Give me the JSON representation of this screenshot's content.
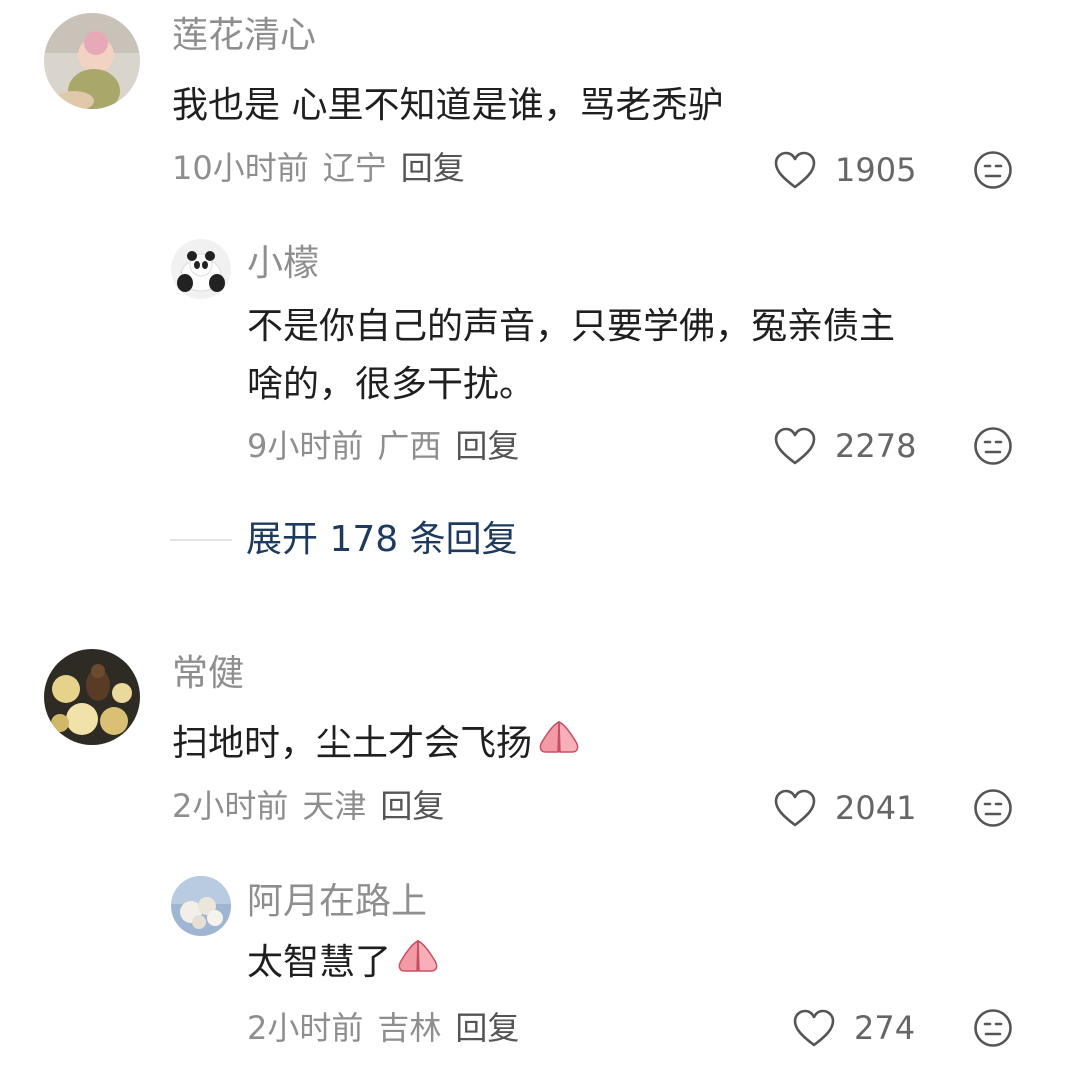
{
  "comments": [
    {
      "user": "莲花清心",
      "text": "我也是 心里不知道是谁，骂老秃驴",
      "time": "10小时前",
      "location": "辽宁",
      "reply_label": "回复",
      "likes": "1905",
      "replies": [
        {
          "user": "小檬",
          "text_line1": "不是你自己的声音，只要学佛，冤亲债主",
          "text_line2": "啥的，很多干扰。",
          "time": "9小时前",
          "location": "广西",
          "reply_label": "回复",
          "likes": "2278"
        }
      ],
      "expand_label": "展开 178 条回复"
    },
    {
      "user": "常健",
      "text": "扫地时，尘土才会飞扬",
      "time": "2小时前",
      "location": "天津",
      "reply_label": "回复",
      "likes": "2041",
      "replies": [
        {
          "user": "阿月在路上",
          "text": "太智慧了",
          "time": "2小时前",
          "location": "吉林",
          "reply_label": "回复",
          "likes": "274"
        }
      ]
    }
  ],
  "icons": {
    "like": "heart-outline-icon",
    "react": "meh-face-icon",
    "emoji": "praying-hands-emoji"
  },
  "colors": {
    "name": "#8e8e8e",
    "text": "#1f1f1f",
    "expand": "#1e3a5f"
  }
}
